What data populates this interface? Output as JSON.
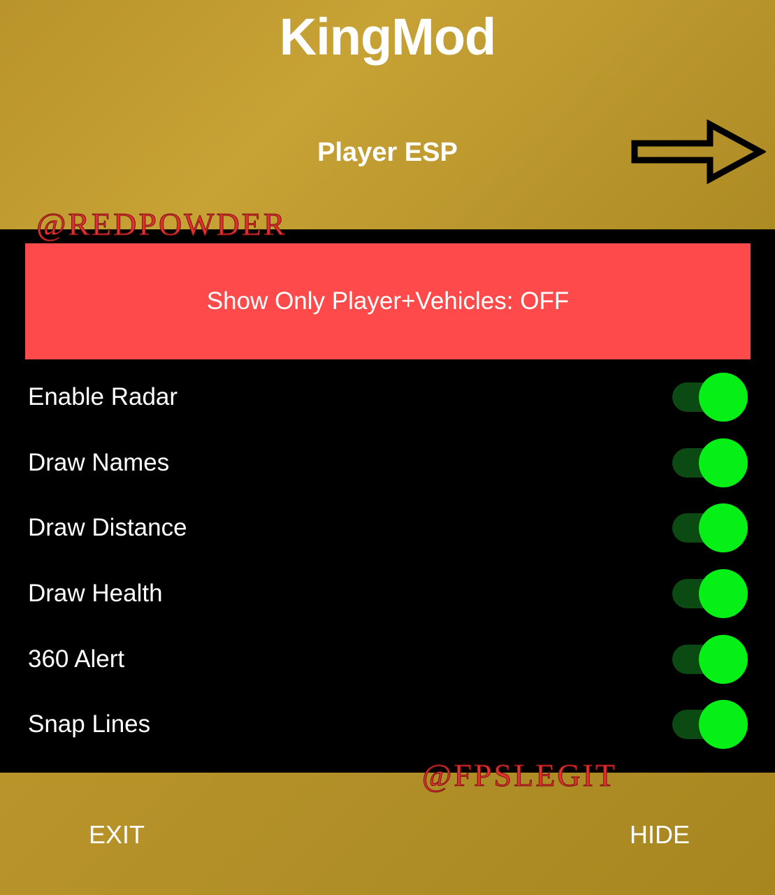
{
  "app": {
    "title": "KingMod"
  },
  "header": {
    "section_title": "Player ESP",
    "next_icon": "right-arrow-icon"
  },
  "watermarks": {
    "top": "@REDPOWDER",
    "bottom": "@FPSLEGIT"
  },
  "main": {
    "filter_button_label": "Show Only Player+Vehicles: OFF",
    "toggles": [
      {
        "label": "Enable Radar",
        "on": true
      },
      {
        "label": "Draw Names",
        "on": true
      },
      {
        "label": "Draw Distance",
        "on": true
      },
      {
        "label": "Draw Health",
        "on": true
      },
      {
        "label": "360 Alert",
        "on": true
      },
      {
        "label": "Snap Lines",
        "on": true
      }
    ]
  },
  "footer": {
    "exit_label": "EXIT",
    "hide_label": "HIDE"
  },
  "colors": {
    "header_gold": "#c29d30",
    "button_red": "#fe4a4a",
    "toggle_on_green": "#06ef17",
    "toggle_track_dark_green": "#0b4a13",
    "content_background": "#000000"
  }
}
